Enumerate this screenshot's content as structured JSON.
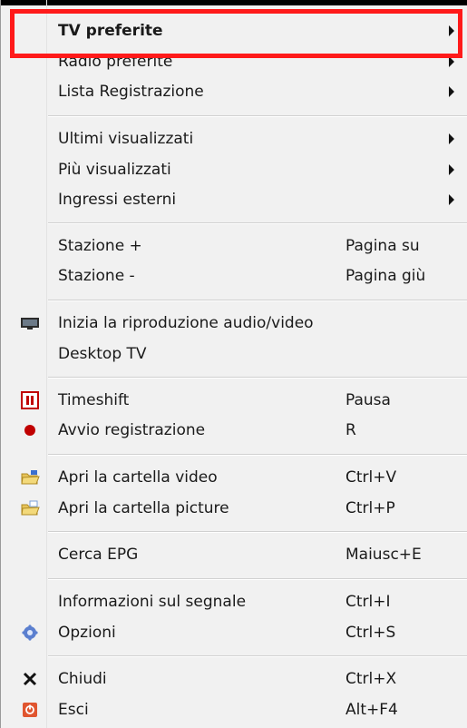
{
  "menu": {
    "items": [
      {
        "label": "TV preferite",
        "submenu": true,
        "bold": true
      },
      {
        "label": "Radio preferite",
        "submenu": true
      },
      {
        "label": "Lista Registrazione",
        "submenu": true
      },
      {
        "label": "Ultimi visualizzati",
        "submenu": true
      },
      {
        "label": "Più visualizzati",
        "submenu": true
      },
      {
        "label": "Ingressi esterni",
        "submenu": true
      },
      {
        "label": "Stazione +",
        "shortcut": "Pagina su"
      },
      {
        "label": "Stazione -",
        "shortcut": "Pagina giù"
      },
      {
        "label": "Inizia la riproduzione audio/video",
        "icon": "monitor-icon"
      },
      {
        "label": "Desktop TV"
      },
      {
        "label": "Timeshift",
        "shortcut": "Pausa",
        "icon": "pause-icon"
      },
      {
        "label": "Avvio registrazione",
        "shortcut": "R",
        "icon": "record-icon"
      },
      {
        "label": "Apri la cartella video",
        "shortcut": "Ctrl+V",
        "icon": "folder-video-icon"
      },
      {
        "label": "Apri la cartella picture",
        "shortcut": "Ctrl+P",
        "icon": "folder-picture-icon"
      },
      {
        "label": "Cerca EPG",
        "shortcut": "Maiusc+E"
      },
      {
        "label": "Informazioni sul segnale",
        "shortcut": "Ctrl+I"
      },
      {
        "label": "Opzioni",
        "shortcut": "Ctrl+S",
        "icon": "gear-icon"
      },
      {
        "label": "Chiudi",
        "shortcut": "Ctrl+X",
        "icon": "close-icon"
      },
      {
        "label": "Esci",
        "shortcut": "Alt+F4",
        "icon": "exit-icon"
      }
    ]
  },
  "colors": {
    "menu_bg": "#f1f1f1",
    "highlight_border": "#ff1a1a",
    "record_red": "#c00000"
  }
}
